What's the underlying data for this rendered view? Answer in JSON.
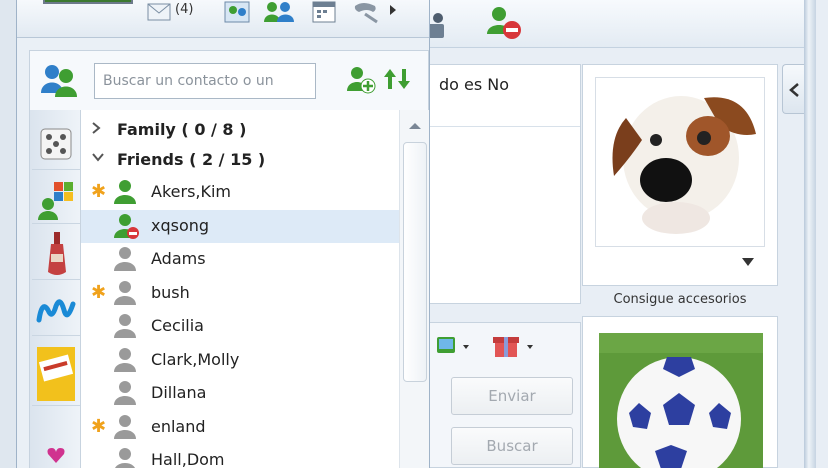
{
  "toolbar": {
    "mail_count": "(4)"
  },
  "search": {
    "placeholder": "Buscar un contacto o un"
  },
  "groups": [
    {
      "label": "Family ( 0 / 8 )",
      "expanded": false
    },
    {
      "label": "Friends ( 2 / 15 )",
      "expanded": true
    }
  ],
  "contacts": [
    {
      "name": "Akers,Kim",
      "starred": true,
      "status": "online"
    },
    {
      "name": "xqsong",
      "starred": false,
      "status": "blocked"
    },
    {
      "name": "Adams",
      "starred": false,
      "status": "offline"
    },
    {
      "name": "bush",
      "starred": true,
      "status": "offline"
    },
    {
      "name": "Cecilia",
      "starred": false,
      "status": "offline"
    },
    {
      "name": "Clark,Molly",
      "starred": false,
      "status": "offline"
    },
    {
      "name": "Dillana",
      "starred": false,
      "status": "offline"
    },
    {
      "name": "enland",
      "starred": true,
      "status": "offline"
    },
    {
      "name": "Hall,Dom",
      "starred": false,
      "status": "offline"
    }
  ],
  "conversation": {
    "message_fragment": "do es No",
    "send_button": "Enviar",
    "search_button": "Buscar",
    "accessories_caption": "Consigue accesorios"
  },
  "colors": {
    "online": "#3f9e32",
    "offline": "#9a9a9a",
    "blocked": "#d8363a",
    "star": "#f0a21c",
    "selected": "#ddeaf7"
  }
}
